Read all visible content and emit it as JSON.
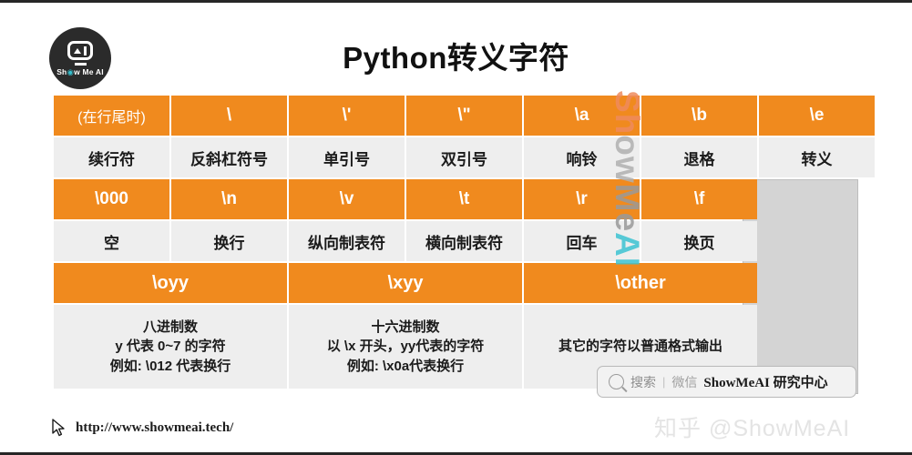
{
  "logo": {
    "brand_text": "Show Me AI",
    "brand_text_pre": "Sh",
    "brand_text_dot": "◉",
    "brand_text_post": "w Me AI"
  },
  "header": {
    "title": "Python转义字符"
  },
  "colors": {
    "accent_orange": "#f08a1e",
    "row_gray": "#eeeeee",
    "empty_block_gray": "#d4d4d4",
    "frame_dark": "#262626",
    "watermark_teal": "#3cc3d2",
    "watermark_orange": "#ef8b5d"
  },
  "table": {
    "rows": [
      {
        "type": "code",
        "cells": [
          "(在行尾时)",
          "\\",
          "\\'",
          "\\\"",
          "\\a",
          "\\b",
          "\\e"
        ]
      },
      {
        "type": "desc",
        "cells": [
          "续行符",
          "反斜杠符号",
          "单引号",
          "双引号",
          "响铃",
          "退格",
          "转义"
        ]
      },
      {
        "type": "code",
        "cells": [
          "\\000",
          "\\n",
          "\\v",
          "\\t",
          "\\r",
          "\\f",
          ""
        ]
      },
      {
        "type": "desc",
        "cells": [
          "空",
          "换行",
          "纵向制表符",
          "横向制表符",
          "回车",
          "换页",
          ""
        ]
      },
      {
        "type": "code-wide",
        "cells": [
          "\\oyy",
          "\\xyy",
          "\\other",
          ""
        ]
      },
      {
        "type": "desc-wide",
        "cells": [
          "八进制数\ny 代表 0~7 的字符\n例如: \\012 代表换行",
          "十六进制数\n以 \\x 开头，yy代表的字符\n例如: \\x0a代表换行",
          "其它的字符以普通格式输出",
          ""
        ]
      }
    ]
  },
  "vertical_watermark": {
    "part_sh": "Sh",
    "part_ow": "ow",
    "part_me": "Me",
    "part_ai": "AI"
  },
  "search_widget": {
    "placeholder": "搜索",
    "separator": "|",
    "channel": "微信",
    "brand": "ShowMeAI 研究中心"
  },
  "footer": {
    "url": "http://www.showmeai.tech/"
  },
  "zhihu_watermark": {
    "text": "知乎 @ShowMeAI"
  }
}
